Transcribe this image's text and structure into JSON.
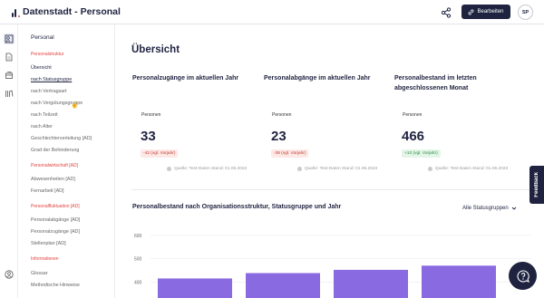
{
  "app": {
    "title": "Datenstadt - Personal",
    "edit_label": "Bearbeiten",
    "avatar_initials": "SP"
  },
  "sidebar": {
    "title": "Personal",
    "groups": [
      {
        "section": "Personalstruktur",
        "items": [
          "Übersicht",
          "nach Statusgruppe",
          "nach Vertragsart",
          "nach Vergütungsgruppe",
          "nach Teilzeit",
          "nach Alter",
          "Geschlechterverteilung [AD]",
          "Grad der Behinderung"
        ]
      },
      {
        "section": "Personalwirtschaft [AD]",
        "items": [
          "Abwesenheiten [AD]",
          "Fernarbeit [AD]"
        ]
      },
      {
        "section": "Personalfluktuation [AD]",
        "items": [
          "Personalabgänge [AD]",
          "Personalzugänge [AD]",
          "Stellenplan [AD]"
        ]
      },
      {
        "section": "Informationen",
        "items": [
          "Glossar",
          "Methodische Hinweise"
        ]
      }
    ]
  },
  "main": {
    "heading": "Übersicht",
    "cards": [
      {
        "title": "Personalzugänge im aktuellen Jahr",
        "label": "Personen",
        "value": "33",
        "delta": "-42 (vgl. Vorjahr)",
        "delta_type": "neg",
        "source": "Quelle: Test-Daten  Stand: 01.06.2023"
      },
      {
        "title": "Personalabgänge im aktuellen Jahr",
        "label": "Personen",
        "value": "23",
        "delta": "-38 (vgl. Vorjahr)",
        "delta_type": "neg",
        "source": "Quelle: Test-Daten  Stand: 01.06.2023"
      },
      {
        "title": "Personalbestand im letzten abgeschlossenen Monat",
        "label": "Personen",
        "value": "466",
        "delta": "+10 (vgl. Vorjahr)",
        "delta_type": "pos",
        "source": "Quelle: Test-Daten  Stand: 01.06.2023"
      }
    ],
    "section_title": "Personalbestand nach Organisationsstruktur, Statusgruppe und Jahr",
    "dropdown_label": "Alle Statusgruppen"
  },
  "chart_data": {
    "type": "bar",
    "ylim": [
      300,
      650
    ],
    "yticks": [
      "600",
      "500",
      "400",
      "300"
    ],
    "categories": [
      "",
      "",
      "",
      ""
    ],
    "values": [
      415,
      438,
      452,
      470
    ],
    "bar_color": "#8a6ae0"
  },
  "feedback_label": "Feedback"
}
